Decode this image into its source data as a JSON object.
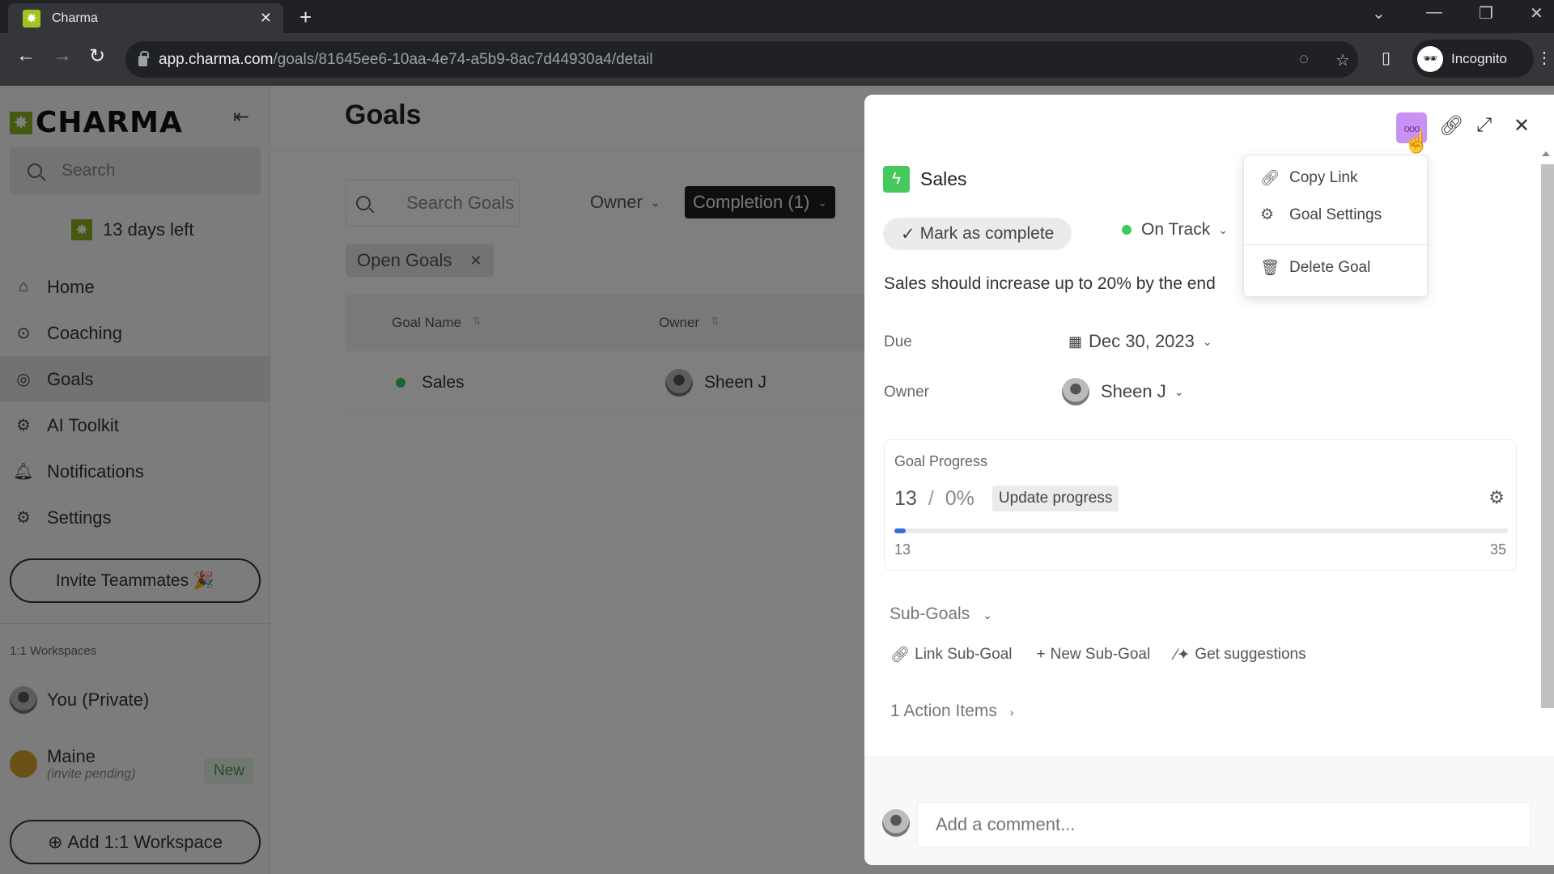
{
  "browser": {
    "tab_title": "Charma",
    "url_host": "app.charma.com",
    "url_path": "/goals/81645ee6-10aa-4e74-a5b9-8ac7d44930a4/detail",
    "profile_label": "Incognito"
  },
  "sidebar": {
    "logo": "CHARMA",
    "search_placeholder": "Search",
    "trial_label": "13 days left",
    "nav": [
      {
        "label": "Home",
        "icon": "home-icon"
      },
      {
        "label": "Coaching",
        "icon": "whistle-icon"
      },
      {
        "label": "Goals",
        "icon": "target-icon",
        "active": true
      },
      {
        "label": "AI Toolkit",
        "icon": "robot-icon"
      },
      {
        "label": "Notifications",
        "icon": "bell-icon"
      },
      {
        "label": "Settings",
        "icon": "gear-icon"
      }
    ],
    "invite_label": "Invite Teammates 🎉",
    "workspaces_heading": "1:1 Workspaces",
    "workspaces": [
      {
        "name": "You (Private)"
      },
      {
        "name": "Maine",
        "sub": "(invite pending)",
        "badge": "New"
      }
    ],
    "add_workspace_label": "Add 1:1 Workspace"
  },
  "main": {
    "title": "Goals",
    "search_placeholder": "Search Goals",
    "filters": {
      "owner": "Owner",
      "completion": "Completion (1)"
    },
    "active_chip": "Open Goals",
    "table": {
      "columns": [
        "Goal Name",
        "Owner"
      ],
      "rows": [
        {
          "goal": "Sales",
          "owner": "Sheen J",
          "status_color": "#3ec95c"
        }
      ]
    }
  },
  "panel": {
    "goal_title": "Sales",
    "mark_complete_label": "Mark as complete",
    "status_label": "On Track",
    "status_color": "#3ec95c",
    "description": "Sales should increase up to 20% by the end",
    "due_label": "Due",
    "due_value": "Dec 30, 2023",
    "owner_label": "Owner",
    "owner_value": "Sheen J",
    "progress": {
      "title": "Goal Progress",
      "current": "13",
      "percent": "0%",
      "update_label": "Update progress",
      "min": "13",
      "max": "35",
      "fill_fraction": 0
    },
    "subgoals_label": "Sub-Goals",
    "subgoal_actions": [
      "Link Sub-Goal",
      "New Sub-Goal",
      "Get suggestions"
    ],
    "action_items_label": "1 Action Items",
    "comment_placeholder": "Add a comment..."
  },
  "menu": {
    "items": [
      {
        "label": "Copy Link",
        "icon": "link-icon"
      },
      {
        "label": "Goal Settings",
        "icon": "gear-icon"
      },
      {
        "label": "Delete Goal",
        "icon": "trash-icon"
      }
    ]
  }
}
